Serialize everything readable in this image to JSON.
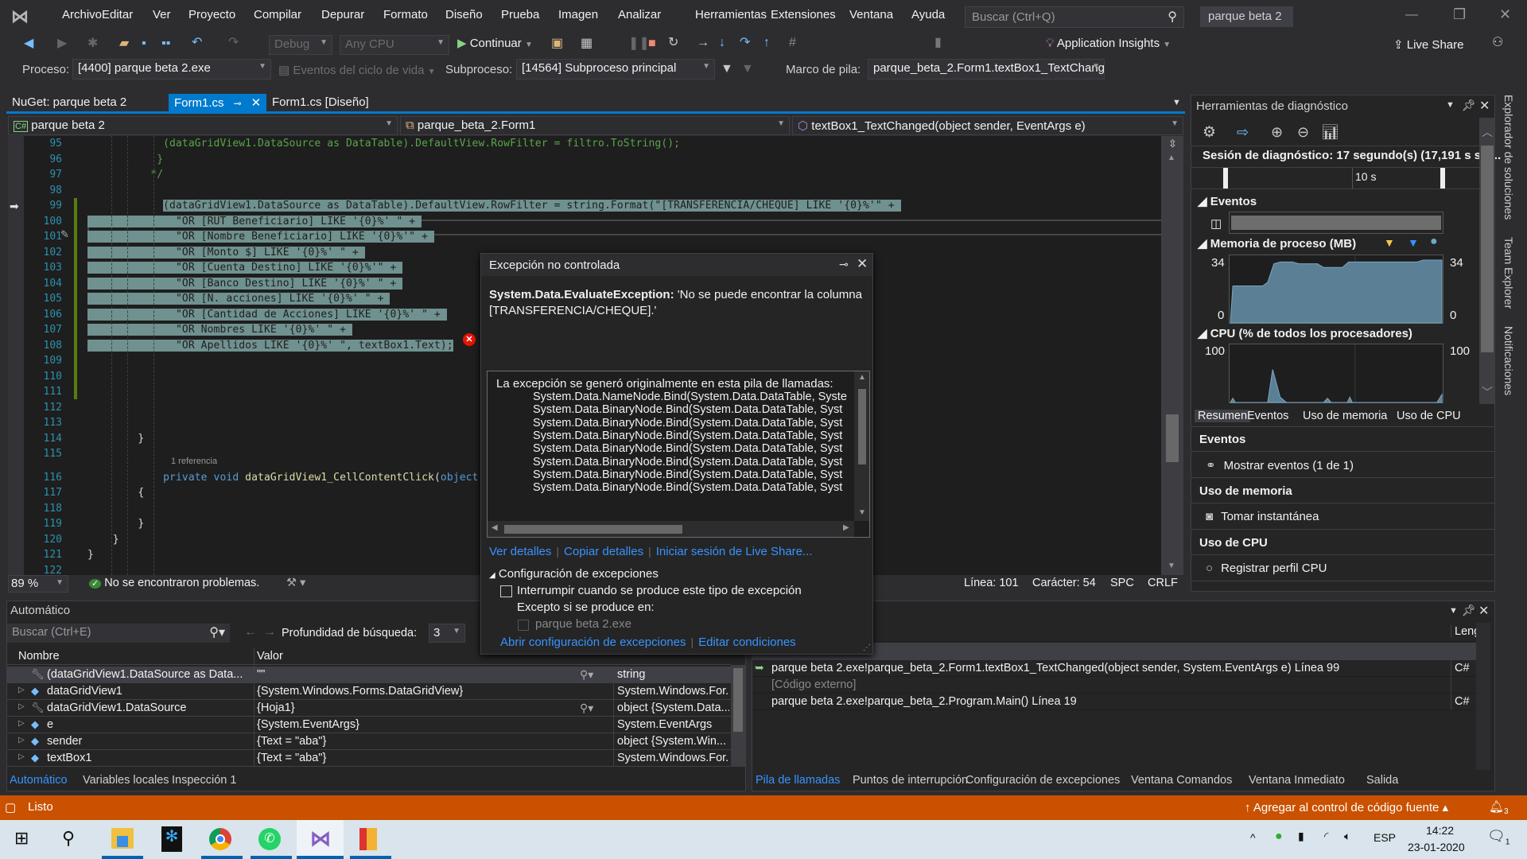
{
  "window": {
    "title": "parque beta 2",
    "search_placeholder": "Buscar (Ctrl+Q)"
  },
  "menu": [
    "Archivo",
    "Editar",
    "Ver",
    "Proyecto",
    "Compilar",
    "Depurar",
    "Formato",
    "Diseño",
    "Prueba",
    "Imagen",
    "Analizar",
    "Herramientas",
    "Extensiones",
    "Ventana",
    "Ayuda"
  ],
  "toolbar": {
    "config": "Debug",
    "platform": "Any CPU",
    "continue": "Continuar",
    "app_insights": "Application Insights",
    "live_share": "Live Share"
  },
  "debugbar": {
    "process_label": "Proceso:",
    "process": "[4400] parque beta 2.exe",
    "lifecycle": "Eventos del ciclo de vida",
    "thread_label": "Subproceso:",
    "thread": "[14564] Subproceso principal",
    "frame_label": "Marco de pila:",
    "frame": "parque_beta_2.Form1.textBox1_TextChang"
  },
  "tabs": [
    {
      "label": "NuGet: parque beta 2",
      "active": false
    },
    {
      "label": "Form1.cs",
      "active": true
    },
    {
      "label": "Form1.cs [Diseño]",
      "active": false
    }
  ],
  "navbar": {
    "project": "parque beta 2",
    "class": "parque_beta_2.Form1",
    "member": "textBox1_TextChanged(object sender, EventArgs e)"
  },
  "editor": {
    "codelens": "1 referencia",
    "lines": [
      {
        "n": "95",
        "segs": [
          {
            "t": "            (dataGridView1.DataSource as DataTable).DefaultView.RowFilter = filtro.ToString();",
            "k": "cm"
          }
        ]
      },
      {
        "n": "96",
        "segs": [
          {
            "t": "           }",
            "k": "cm"
          }
        ]
      },
      {
        "n": "97",
        "segs": [
          {
            "t": "          */",
            "k": "cm"
          }
        ]
      },
      {
        "n": "98",
        "segs": []
      },
      {
        "n": "99",
        "segs": [
          {
            "t": "            ",
            "k": "pl"
          },
          {
            "t": "(dataGridView1.DataSource as DataTable).DefaultView.RowFilter = string.Format(\"[TRANSFERENCIA/CHEQUE] LIKE '{0}%'\" + ",
            "k": "sel"
          }
        ]
      },
      {
        "n": "100",
        "segs": [
          {
            "t": "              \"OR [RUT Beneficiario] LIKE '{0}%' \" + ",
            "k": "sel"
          }
        ]
      },
      {
        "n": "101",
        "segs": [
          {
            "t": "              \"OR [Nombre Beneficiario] LIKE '{0}%'\" + ",
            "k": "sel"
          }
        ]
      },
      {
        "n": "102",
        "segs": [
          {
            "t": "              \"OR [Monto $] LIKE '{0}%' \" + ",
            "k": "sel"
          }
        ]
      },
      {
        "n": "103",
        "segs": [
          {
            "t": "              \"OR [Cuenta Destino] LIKE '{0}%'\" + ",
            "k": "sel"
          }
        ]
      },
      {
        "n": "104",
        "segs": [
          {
            "t": "              \"OR [Banco Destino] LIKE '{0}%' \" + ",
            "k": "sel"
          }
        ]
      },
      {
        "n": "105",
        "segs": [
          {
            "t": "              \"OR [N. acciones] LIKE '{0}%' \" + ",
            "k": "sel"
          }
        ]
      },
      {
        "n": "106",
        "segs": [
          {
            "t": "              \"OR [Cantidad de Acciones] LIKE '{0}%' \" + ",
            "k": "sel"
          }
        ]
      },
      {
        "n": "107",
        "segs": [
          {
            "t": "              \"OR Nombres LIKE '{0}%' \" + ",
            "k": "sel"
          }
        ]
      },
      {
        "n": "108",
        "segs": [
          {
            "t": "              \"OR Apellidos LIKE '{0}%' \", textBox1.Text);",
            "k": "sel"
          }
        ]
      },
      {
        "n": "109",
        "segs": []
      },
      {
        "n": "110",
        "segs": []
      },
      {
        "n": "111",
        "segs": []
      },
      {
        "n": "112",
        "segs": []
      },
      {
        "n": "113",
        "segs": []
      },
      {
        "n": "114",
        "segs": [
          {
            "t": "        }",
            "k": "pl"
          }
        ]
      },
      {
        "n": "115",
        "segs": []
      },
      {
        "n": "116",
        "lens": true,
        "segs": [
          {
            "t": "            ",
            "k": "pl"
          },
          {
            "t": "private void ",
            "k": "kw"
          },
          {
            "t": "dataGridView1_CellContentClick",
            "k": "fn"
          },
          {
            "t": "(",
            "k": "pl"
          },
          {
            "t": "object",
            "k": "kw"
          }
        ]
      },
      {
        "n": "117",
        "segs": [
          {
            "t": "        {",
            "k": "pl"
          }
        ]
      },
      {
        "n": "118",
        "segs": []
      },
      {
        "n": "119",
        "segs": [
          {
            "t": "        }",
            "k": "pl"
          }
        ]
      },
      {
        "n": "120",
        "segs": [
          {
            "t": "    }",
            "k": "pl"
          }
        ]
      },
      {
        "n": "121",
        "segs": [
          {
            "t": "}",
            "k": "pl"
          }
        ]
      },
      {
        "n": "122",
        "segs": []
      }
    ]
  },
  "editor_status": {
    "zoom": "89 %",
    "issues": "No se encontraron problemas.",
    "line": "Línea: 101",
    "char": "Carácter: 54",
    "spc": "SPC",
    "eol": "CRLF"
  },
  "exception": {
    "title": "Excepción no controlada",
    "type": "System.Data.EvaluateException:",
    "message": " 'No se puede encontrar la columna [TRANSFERENCIA/CHEQUE].'",
    "stack_header": "La excepción se generó originalmente en esta pila de llamadas:",
    "stack": [
      "System.Data.NameNode.Bind(System.Data.DataTable, Syste",
      "System.Data.BinaryNode.Bind(System.Data.DataTable, Syst",
      "System.Data.BinaryNode.Bind(System.Data.DataTable, Syst",
      "System.Data.BinaryNode.Bind(System.Data.DataTable, Syst",
      "System.Data.BinaryNode.Bind(System.Data.DataTable, Syst",
      "System.Data.BinaryNode.Bind(System.Data.DataTable, Syst",
      "System.Data.BinaryNode.Bind(System.Data.DataTable, Syst",
      "System.Data.BinaryNode.Bind(System.Data.DataTable, Syst"
    ],
    "links": [
      "Ver detalles",
      "Copiar detalles",
      "Iniciar sesión de Live Share..."
    ],
    "config_title": "Configuración de excepciones",
    "break_label": "Interrumpir cuando se produce este tipo de excepción",
    "break_checked": false,
    "except_label": "Excepto si se produce en:",
    "except_item": "parque beta 2.exe",
    "links2": [
      "Abrir configuración de excepciones",
      "Editar condiciones"
    ]
  },
  "diag": {
    "title": "Herramientas de diagnóstico",
    "session": "Sesión de diagnóstico: 17 segundo(s) (17,191 s sel...",
    "tick": "10 s",
    "events_title": "Eventos",
    "memory_title": "Memoria de proceso (MB)",
    "memory_max": "34",
    "memory_min": "0",
    "memory_samples": [
      [
        0,
        0
      ],
      [
        0.2,
        20
      ],
      [
        2.6,
        20
      ],
      [
        3,
        22
      ],
      [
        3.5,
        32
      ],
      [
        4,
        33
      ],
      [
        5,
        33
      ],
      [
        5.5,
        32
      ],
      [
        7,
        32
      ],
      [
        7.5,
        30
      ],
      [
        9,
        30
      ],
      [
        9.5,
        33
      ],
      [
        15,
        33
      ],
      [
        15.5,
        34
      ],
      [
        17,
        34
      ]
    ],
    "cpu_title": "CPU (% de todos los procesadores)",
    "cpu_max": "100",
    "cpu_min": "0",
    "cpu_samples": [
      [
        0,
        0
      ],
      [
        0.2,
        8
      ],
      [
        0.4,
        0
      ],
      [
        3,
        0
      ],
      [
        3.4,
        62
      ],
      [
        4,
        10
      ],
      [
        4.5,
        0
      ],
      [
        7.5,
        0
      ],
      [
        7.8,
        8
      ],
      [
        8.1,
        0
      ],
      [
        9.4,
        0
      ],
      [
        9.6,
        10
      ],
      [
        9.8,
        0
      ],
      [
        16.6,
        0
      ],
      [
        17,
        15
      ]
    ],
    "tabs": [
      "Resumen",
      "Eventos",
      "Uso de memoria",
      "Uso de CPU"
    ],
    "sections": [
      {
        "title": "Eventos",
        "action": "Mostrar eventos (1 de 1)"
      },
      {
        "title": "Uso de memoria",
        "action": "Tomar instantánea"
      },
      {
        "title": "Uso de CPU",
        "action": "Registrar perfil CPU"
      }
    ]
  },
  "side_tabs": [
    "Explorador de soluciones",
    "Team Explorer",
    "Notificaciones"
  ],
  "autos": {
    "title": "Automático",
    "search_placeholder": "Buscar (Ctrl+E)",
    "depth_label": "Profundidad de búsqueda:",
    "depth": "3",
    "columns": [
      "Nombre",
      "Valor"
    ],
    "rows": [
      {
        "name": "(dataGridView1.DataSource as Data...",
        "value": "\"\"",
        "type": "string",
        "icon": "wrench"
      },
      {
        "name": "dataGridView1",
        "value": "{System.Windows.Forms.DataGridView}",
        "type": "System.Windows.For...",
        "icon": "field-private"
      },
      {
        "name": "dataGridView1.DataSource",
        "value": "{Hoja1}",
        "type": "object {System.Data...",
        "icon": "wrench"
      },
      {
        "name": "e",
        "value": "{System.EventArgs}",
        "type": "System.EventArgs",
        "icon": "local"
      },
      {
        "name": "sender",
        "value": "{Text = \"aba\"}",
        "type": "object {System.Win...",
        "icon": "local"
      },
      {
        "name": "textBox1",
        "value": "{Text = \"aba\"}",
        "type": "System.Windows.For...",
        "icon": "field-private"
      }
    ],
    "tabs": [
      "Automático",
      "Variables locales",
      "Inspección 1"
    ]
  },
  "callstack": {
    "lang_header": "Leng",
    "rows": [
      {
        "name": "parque beta 2.exe!parque_beta_2.Form1.textBox1_TextChanged(object sender, System.EventArgs e) Línea 99",
        "lang": "C#",
        "current": true
      },
      {
        "name": "[Código externo]",
        "lang": "",
        "external": true
      },
      {
        "name": "parque beta 2.exe!parque_beta_2.Program.Main() Línea 19",
        "lang": "C#"
      }
    ],
    "tabs": [
      "Pila de llamadas",
      "Puntos de interrupción",
      "Configuración de excepciones",
      "Ventana Comandos",
      "Ventana Inmediato",
      "Salida"
    ]
  },
  "statusbar": {
    "text": "Listo",
    "source_control": "Agregar al control de código fuente",
    "notifications": "3",
    "color": "#ca5100"
  },
  "taskbar": {
    "lang": "ESP",
    "time": "14:22",
    "date": "23-01-2020",
    "notif_count": "1"
  }
}
